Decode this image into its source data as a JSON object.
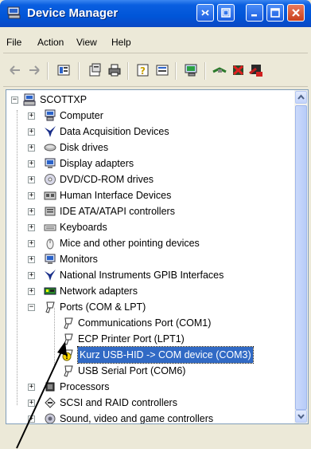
{
  "window": {
    "title": "Device Manager",
    "accent": "#0055d8"
  },
  "menu": {
    "items": [
      {
        "label": "File"
      },
      {
        "label": "Action"
      },
      {
        "label": "View"
      },
      {
        "label": "Help"
      }
    ]
  },
  "toolbar": {
    "buttons": [
      "back-icon",
      "forward-icon",
      "view-icon",
      "properties-icon",
      "print-icon",
      "help-icon",
      "view-devices-icon",
      "scan-hardware-icon",
      "update-driver-icon",
      "disable-icon",
      "uninstall-icon"
    ]
  },
  "tree": {
    "root": "SCOTTXP",
    "categories": [
      {
        "label": "Computer",
        "icon": "computer-icon"
      },
      {
        "label": "Data Acquisition Devices",
        "icon": "ni-eagle-icon"
      },
      {
        "label": "Disk drives",
        "icon": "disk-drive-icon"
      },
      {
        "label": "Display adapters",
        "icon": "monitor-icon"
      },
      {
        "label": "DVD/CD-ROM drives",
        "icon": "cdrom-icon"
      },
      {
        "label": "Human Interface Devices",
        "icon": "hid-icon"
      },
      {
        "label": "IDE ATA/ATAPI controllers",
        "icon": "ide-controller-icon"
      },
      {
        "label": "Keyboards",
        "icon": "keyboard-icon"
      },
      {
        "label": "Mice and other pointing devices",
        "icon": "mouse-icon"
      },
      {
        "label": "Monitors",
        "icon": "monitor-icon"
      },
      {
        "label": "National Instruments GPIB Interfaces",
        "icon": "ni-eagle-icon"
      },
      {
        "label": "Network adapters",
        "icon": "network-card-icon"
      },
      {
        "label": "Ports (COM & LPT)",
        "icon": "port-icon"
      }
    ],
    "ports_children": [
      {
        "label": "Communications Port (COM1)",
        "icon": "port-icon"
      },
      {
        "label": "ECP Printer Port (LPT1)",
        "icon": "port-icon"
      },
      {
        "label": "Kurz USB-HID -> COM device (COM3)",
        "icon": "port-warning-icon",
        "selected": true
      },
      {
        "label": "USB Serial Port (COM6)",
        "icon": "port-icon"
      }
    ],
    "after_ports": [
      {
        "label": "Processors",
        "icon": "processor-icon"
      },
      {
        "label": "SCSI and RAID controllers",
        "icon": "scsi-icon"
      },
      {
        "label": "Sound, video and game controllers",
        "icon": "sound-icon"
      }
    ]
  }
}
